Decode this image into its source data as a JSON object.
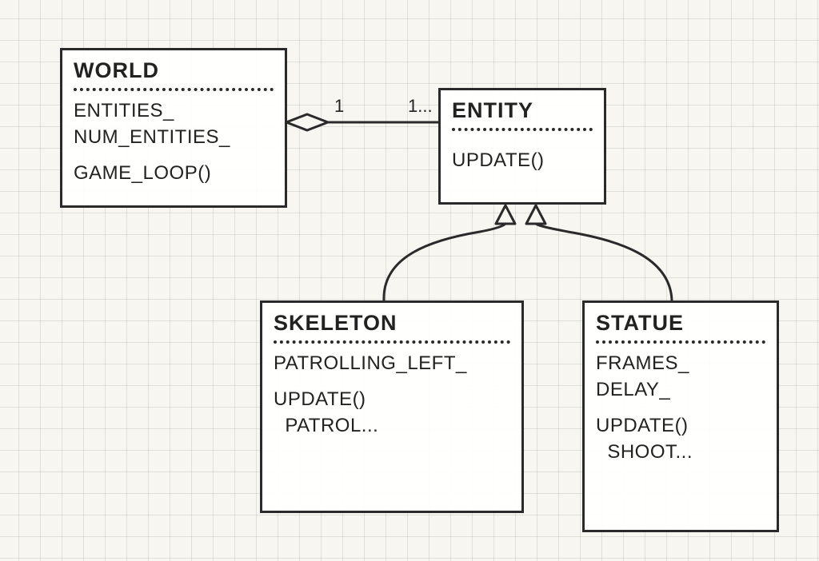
{
  "relation": {
    "aggregation_source_multiplicity": "1",
    "aggregation_target_multiplicity": "1..."
  },
  "world": {
    "name": "WORLD",
    "attributes": [
      "ENTITIES_",
      "NUM_ENTITIES_"
    ],
    "methods": [
      "GAME_LOOP()"
    ]
  },
  "entity": {
    "name": "ENTITY",
    "methods": [
      "UPDATE()"
    ]
  },
  "skeleton": {
    "name": "SKELETON",
    "attributes": [
      "PATROLLING_LEFT_"
    ],
    "methods": [
      "UPDATE()"
    ],
    "method_body": "  PATROL..."
  },
  "statue": {
    "name": "STATUE",
    "attributes": [
      "FRAMES_",
      "DELAY_"
    ],
    "methods": [
      "UPDATE()"
    ],
    "method_body": "  SHOOT..."
  }
}
